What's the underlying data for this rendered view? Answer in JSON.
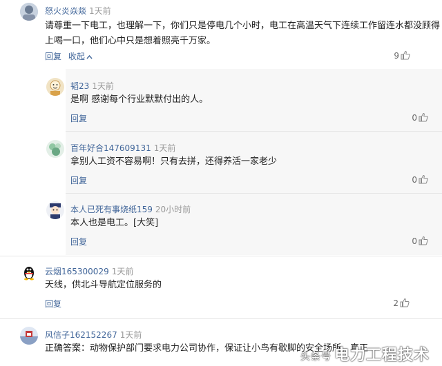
{
  "comments": [
    {
      "user": "怒火炎焱燚",
      "time": "1天前",
      "text_line1": "请尊重一下电工，也理解一下，你们只是停电几个小时，电工在高温天气下连续工作留连水都没顾得",
      "text_line2": "上喝一口，他们心中只是想着照亮千万家。",
      "reply_label": "回复",
      "collapse_label": "收起",
      "likes": "9"
    },
    {
      "user": "韬23",
      "time": "1天前",
      "text": "是啊 感谢每个行业默默付出的人。",
      "reply_label": "回复",
      "likes": "0"
    },
    {
      "user": "百年好合147609131",
      "time": "1天前",
      "text": "拿别人工资不容易啊！只有去拼，还得养活一家老少",
      "reply_label": "回复",
      "likes": "0"
    },
    {
      "user": "本人已死有事烧纸159",
      "time": "20小时前",
      "text": "本人也是电工。[大笑]",
      "reply_label": "回复",
      "likes": "0"
    },
    {
      "user": "云烟165300029",
      "time": "1天前",
      "text": "天线，供北斗导航定位服务的",
      "reply_label": "回复",
      "likes": "2"
    },
    {
      "user": "风信子162152267",
      "time": "1天前",
      "text": "正确答案：动物保护部门要求电力公司协作，保证让小鸟有歇脚的安全场所，真正"
    }
  ],
  "watermark": {
    "prefix": "头条号",
    "text": "电力工程技术"
  },
  "icons": {
    "like": "thumbs-up-icon",
    "collapse": "chevron-up-icon"
  }
}
